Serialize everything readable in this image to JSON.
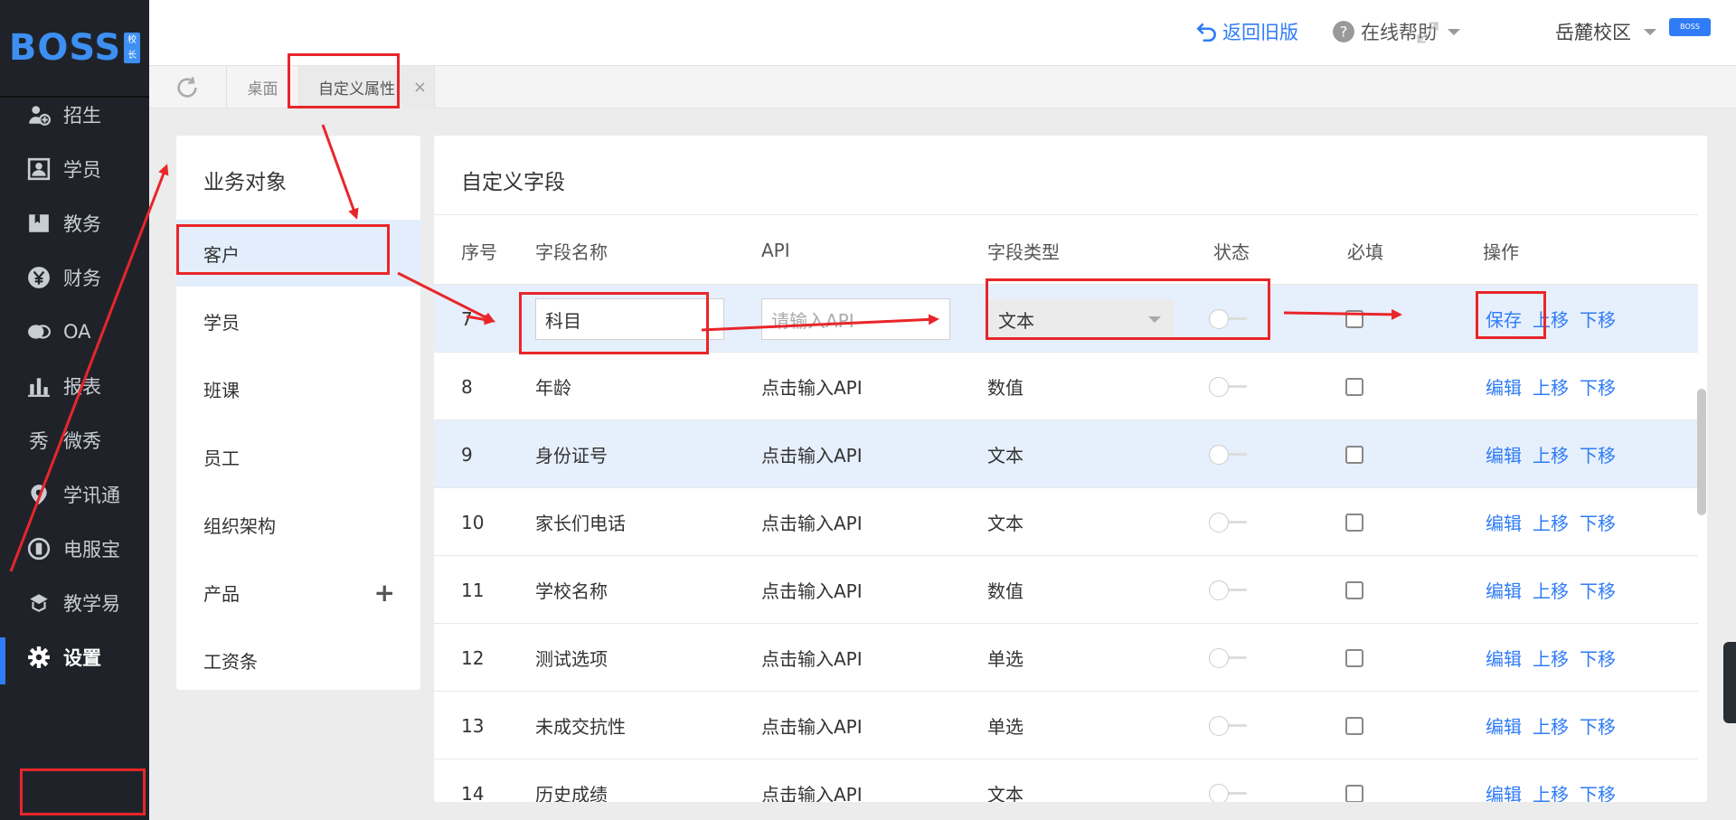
{
  "logo": {
    "text": "BOSS",
    "badge": "校长"
  },
  "nav": {
    "items": [
      {
        "label": "招生",
        "icon": "user-add-icon"
      },
      {
        "label": "学员",
        "icon": "student-icon"
      },
      {
        "label": "教务",
        "icon": "book-icon"
      },
      {
        "label": "财务",
        "icon": "yen-icon"
      },
      {
        "label": "OA",
        "icon": "chat-icon"
      },
      {
        "label": "报表",
        "icon": "chart-icon"
      },
      {
        "label": "微秀",
        "icon": "xiu-icon"
      },
      {
        "label": "学讯通",
        "icon": "location-icon"
      },
      {
        "label": "电服宝",
        "icon": "phone-icon"
      },
      {
        "label": "教学易",
        "icon": "teach-icon"
      },
      {
        "label": "设置",
        "icon": "gear-icon"
      }
    ]
  },
  "topbar": {
    "back_label": "返回旧版",
    "help_label": "在线帮助",
    "campus_label": "岳麓校区",
    "avatar_text": "BOSS"
  },
  "tabs": {
    "desktop": "桌面",
    "custom": "自定义属性",
    "close": "×"
  },
  "left_panel": {
    "title": "业务对象",
    "items": [
      "客户",
      "学员",
      "班课",
      "员工",
      "组织架构",
      "产品",
      "工资条"
    ],
    "add_symbol": "+"
  },
  "right_panel": {
    "title": "自定义字段",
    "headers": {
      "no": "序号",
      "name": "字段名称",
      "api": "API",
      "type": "字段类型",
      "status": "状态",
      "required": "必填",
      "ops": "操作"
    },
    "edit_row": {
      "no": "7",
      "name_value": "科目",
      "api_placeholder": "请输入API",
      "type_value": "文本",
      "save": "保存",
      "up": "上移",
      "down": "下移"
    },
    "rows": [
      {
        "no": "8",
        "name": "年龄",
        "api": "点击输入API",
        "type": "数值"
      },
      {
        "no": "9",
        "name": "身份证号",
        "api": "点击输入API",
        "type": "文本"
      },
      {
        "no": "10",
        "name": "家长们电话",
        "api": "点击输入API",
        "type": "文本"
      },
      {
        "no": "11",
        "name": "学校名称",
        "api": "点击输入API",
        "type": "数值"
      },
      {
        "no": "12",
        "name": "测试选项",
        "api": "点击输入API",
        "type": "单选"
      },
      {
        "no": "13",
        "name": "未成交抗性",
        "api": "点击输入API",
        "type": "单选"
      },
      {
        "no": "14",
        "name": "历史成绩",
        "api": "点击输入API",
        "type": "文本"
      }
    ],
    "ops": {
      "edit": "编辑",
      "up": "上移",
      "down": "下移"
    }
  },
  "colors": {
    "accent": "#2f7cf6",
    "sidebar": "#1f2329",
    "annotation": "#e8262a",
    "highlight_row": "#e6effc"
  }
}
